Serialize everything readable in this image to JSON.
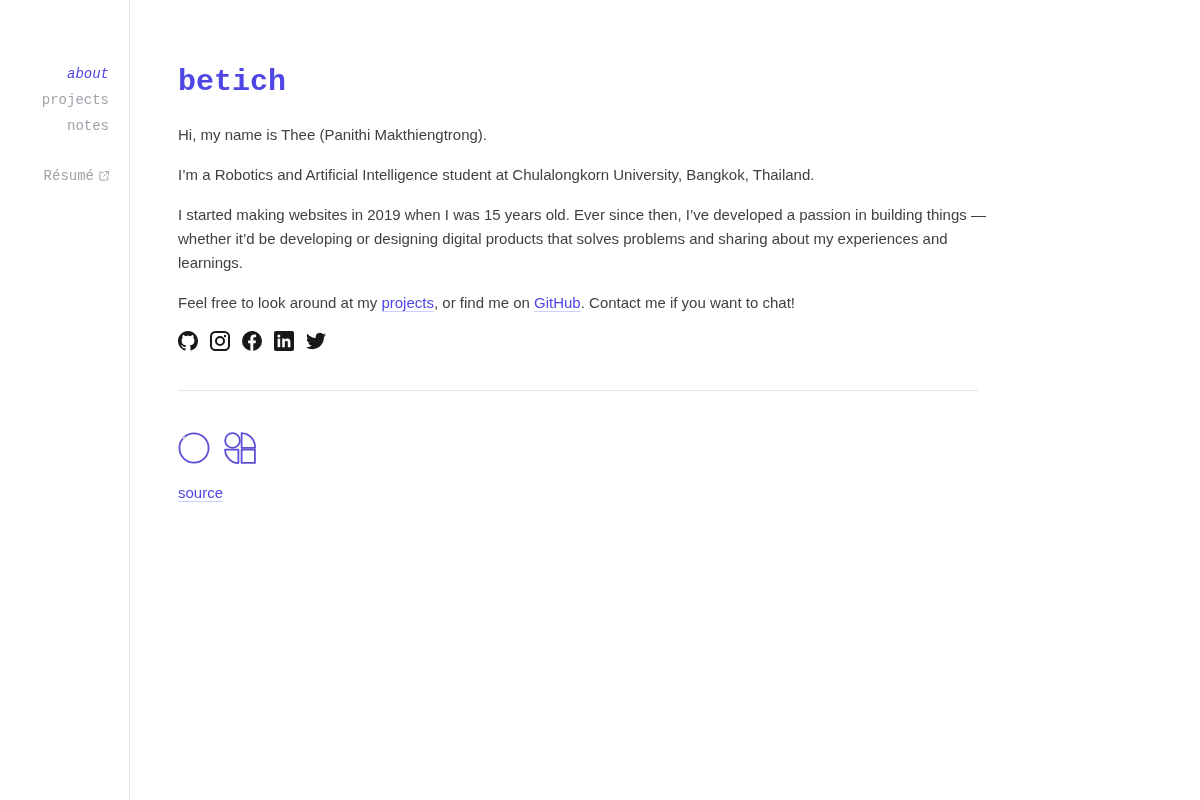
{
  "sidebar": {
    "nav": [
      {
        "label": "about",
        "selected": true
      },
      {
        "label": "projects",
        "selected": false
      },
      {
        "label": "notes",
        "selected": false
      }
    ],
    "resume": {
      "label": "Résumé"
    }
  },
  "content": {
    "title": "betich",
    "paragraphs": [
      {
        "parts": [
          {
            "kind": "text",
            "text": "Hi, my name is Thee (Panithi Makthiengtrong)."
          }
        ]
      },
      {
        "parts": [
          {
            "kind": "text",
            "text": "I’m a Robotics and Artificial Intelligence student at Chulalongkorn University, Bangkok, Thailand."
          }
        ]
      },
      {
        "parts": [
          {
            "kind": "text",
            "text": "I started making websites in 2019 when I was 15 years old. Ever since then, I’ve developed a passion in building things — whether it’d be developing or designing digital products that solves problems and sharing about my experiences and learnings."
          }
        ]
      },
      {
        "parts": [
          {
            "kind": "text",
            "text": "Feel free to look around at my "
          },
          {
            "kind": "link",
            "text": "projects"
          },
          {
            "kind": "text",
            "text": ", or find me on "
          },
          {
            "kind": "link",
            "text": "GitHub"
          },
          {
            "kind": "text",
            "text": ". Contact me if you want to chat!"
          }
        ]
      }
    ],
    "social_links": [
      {
        "kind": "github"
      },
      {
        "kind": "instagram"
      },
      {
        "kind": "facebook"
      },
      {
        "kind": "linkedin"
      },
      {
        "kind": "twitter"
      }
    ],
    "badges": [
      {
        "kind": "ring"
      },
      {
        "kind": "shapes"
      }
    ],
    "source_link": {
      "label": "source"
    }
  }
}
